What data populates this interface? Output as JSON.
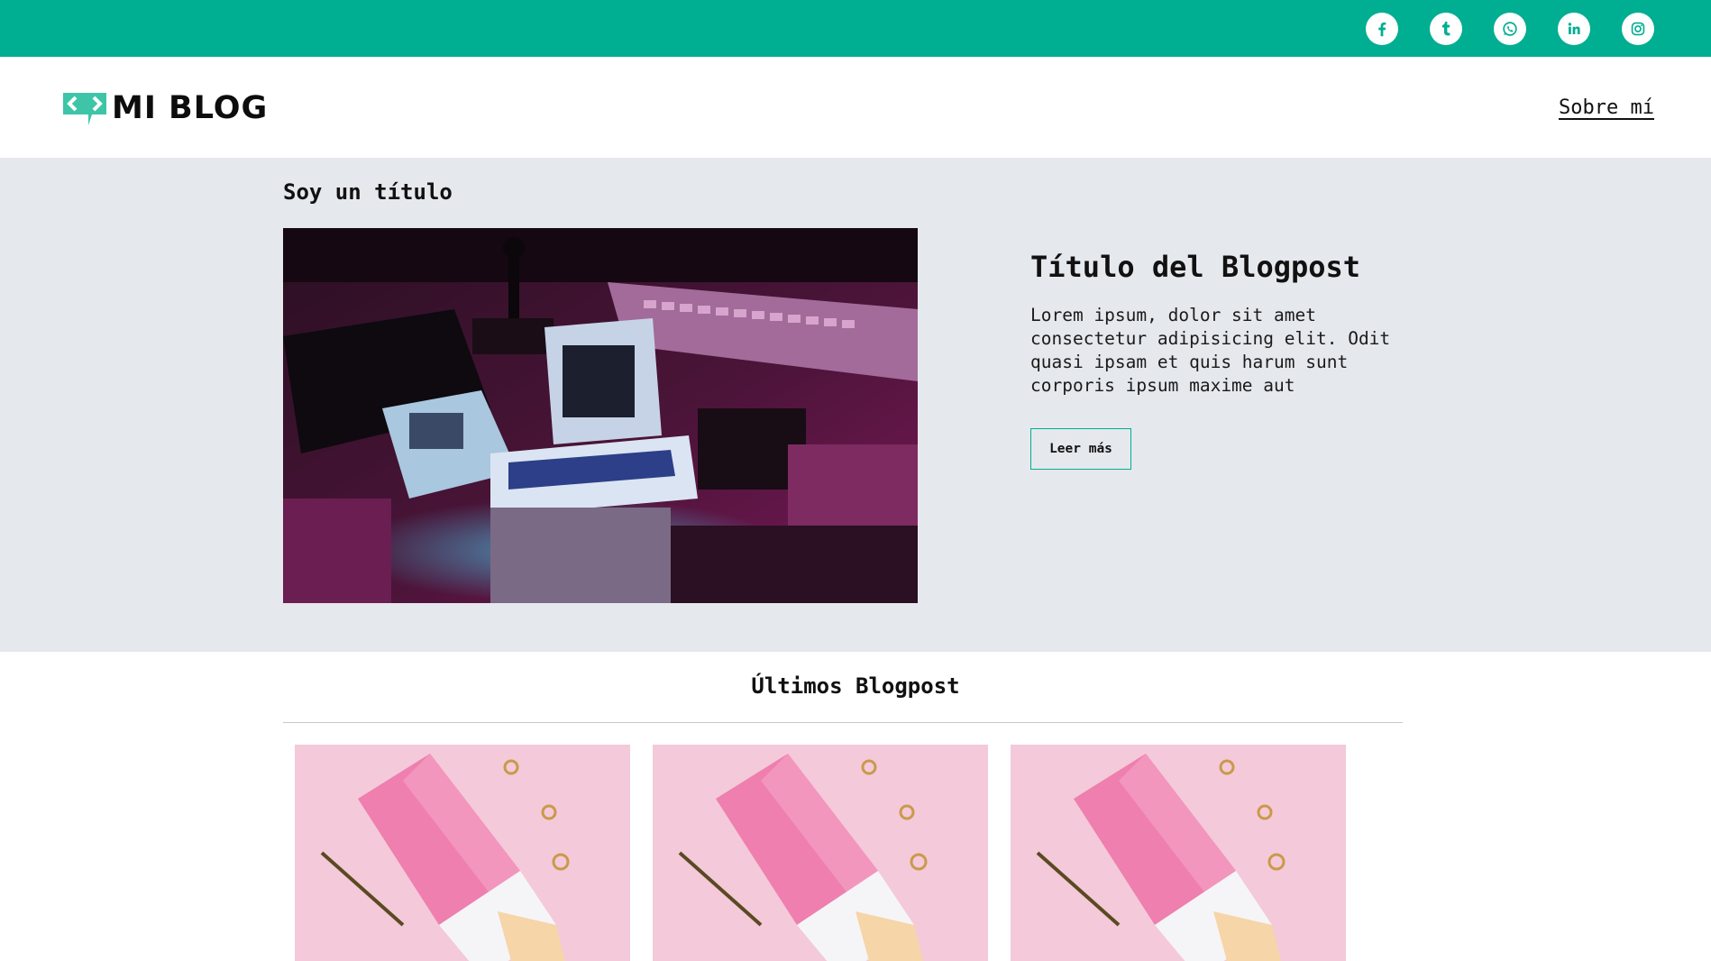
{
  "social": [
    {
      "name": "facebook-icon",
      "label": "f"
    },
    {
      "name": "tumblr-icon",
      "label": "t"
    },
    {
      "name": "whatsapp-icon",
      "label": ""
    },
    {
      "name": "linkedin-icon",
      "label": "in"
    },
    {
      "name": "instagram-icon",
      "label": ""
    }
  ],
  "header": {
    "logo_text": "MI BLOG",
    "nav_link": "Sobre mí"
  },
  "hero": {
    "section_title": "Soy un título",
    "post_title": "Título del Blogpost",
    "post_text": "Lorem ipsum, dolor sit amet consectetur adipisicing elit. Odit quasi ipsam et quis harum sunt corporis ipsum maxime aut",
    "button_label": "Leer más"
  },
  "latest": {
    "title": "Últimos Blogpost"
  },
  "colors": {
    "accent": "#00ae92",
    "hero_bg": "#e5e8ed"
  }
}
